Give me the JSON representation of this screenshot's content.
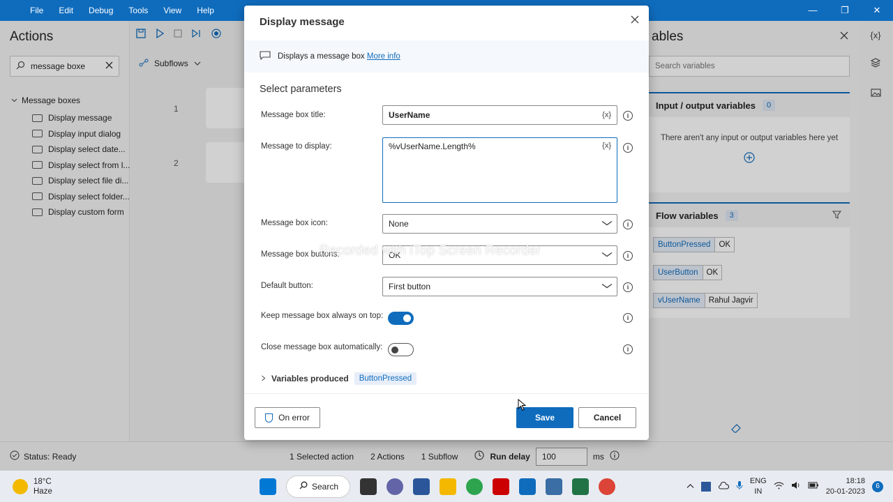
{
  "menu": [
    "File",
    "Edit",
    "Debug",
    "Tools",
    "View",
    "Help"
  ],
  "window_controls": {
    "minimize": "—",
    "maximize": "❐",
    "close": "✕"
  },
  "actions_pane": {
    "title": "Actions",
    "search_value": "message boxe",
    "group": "Message boxes",
    "items": [
      "Display message",
      "Display input dialog",
      "Display select date...",
      "Display select from l...",
      "Display select file di...",
      "Display select folder...",
      "Display custom form"
    ]
  },
  "designer": {
    "subflows_label": "Subflows",
    "step_numbers": [
      "1",
      "2"
    ]
  },
  "variables_pane": {
    "title": "ables",
    "search_placeholder": "Search variables",
    "io_title": "Input / output variables",
    "io_count": "0",
    "io_empty": "There aren't any input or output variables here yet",
    "flow_title": "Flow variables",
    "flow_count": "3",
    "flow_vars": [
      {
        "name": "ButtonPressed",
        "value": "OK"
      },
      {
        "name": "UserButton",
        "value": "OK"
      },
      {
        "name": "vUserName",
        "value": "Rahul Jagvir"
      }
    ]
  },
  "dialog": {
    "title": "Display message",
    "info_text": "Displays a message box",
    "info_link": "More info",
    "section": "Select parameters",
    "title_label": "Message box title:",
    "title_value": "UserName",
    "message_label": "Message to display:",
    "message_value": "%vUserName.Length%",
    "icon_label": "Message box icon:",
    "icon_value": "None",
    "buttons_label": "Message box buttons:",
    "buttons_value": "OK",
    "default_label": "Default button:",
    "default_value": "First button",
    "ontop_label": "Keep message box always on top:",
    "ontop_on": true,
    "autoclose_label": "Close message box automatically:",
    "autoclose_on": false,
    "variables_produced_label": "Variables produced",
    "variables_produced": "ButtonPressed",
    "var_button": "{x}",
    "on_error": "On error",
    "save": "Save",
    "cancel": "Cancel"
  },
  "watermark": "Recorded with iTop Screen Recorder",
  "statusbar": {
    "status": "Status: Ready",
    "selected": "1 Selected action",
    "actions": "2 Actions",
    "subflow": "1 Subflow",
    "run_delay_label": "Run delay",
    "run_delay_value": "100",
    "unit": "ms"
  },
  "taskbar": {
    "temp": "18°C",
    "weather": "Haze",
    "search": "Search",
    "lang1": "ENG",
    "lang2": "IN",
    "time": "18:18",
    "date": "20-01-2023",
    "notifications": "6"
  },
  "colors": {
    "accent": "#0f6cbd"
  }
}
